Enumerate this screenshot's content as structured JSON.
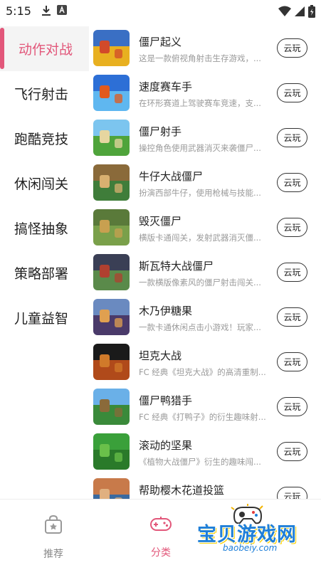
{
  "status_bar": {
    "time": "5:15"
  },
  "sidebar": {
    "items": [
      {
        "label": "动作对战",
        "active": true
      },
      {
        "label": "飞行射击",
        "active": false
      },
      {
        "label": "跑酷竞技",
        "active": false
      },
      {
        "label": "休闲闯关",
        "active": false
      },
      {
        "label": "搞怪抽象",
        "active": false
      },
      {
        "label": "策略部署",
        "active": false
      },
      {
        "label": "儿童益智",
        "active": false
      }
    ]
  },
  "games": [
    {
      "title": "僵尸起义",
      "desc": "这是一款俯视角射击生存游戏，...",
      "button": "云玩",
      "thumb_colors": [
        "#3a6fc4",
        "#e8b020",
        "#d24a2a"
      ]
    },
    {
      "title": "速度赛车手",
      "desc": "在环形赛道上驾驶赛车竞速，支...",
      "button": "云玩",
      "thumb_colors": [
        "#2d6fd6",
        "#5fb7f0",
        "#e25a1c"
      ]
    },
    {
      "title": "僵尸射手",
      "desc": "操控角色使用武器消灭来袭僵尸...",
      "button": "云玩",
      "thumb_colors": [
        "#7cc5ef",
        "#4fa43b",
        "#e6d6a0"
      ]
    },
    {
      "title": "牛仔大战僵尸",
      "desc": "扮演西部牛仔，使用枪械与技能...",
      "button": "云玩",
      "thumb_colors": [
        "#8a6a3a",
        "#3f7d3a",
        "#d8b070"
      ]
    },
    {
      "title": "毁灭僵尸",
      "desc": "横版卡通闯关，发射武器消灭僵...",
      "button": "云玩",
      "thumb_colors": [
        "#5a7a3a",
        "#7aa04a",
        "#c8a050"
      ]
    },
    {
      "title": "斯瓦特大战僵尸",
      "desc": "一款横版像素风的僵尸射击闯关...",
      "button": "云玩",
      "thumb_colors": [
        "#3a3f55",
        "#5a8a4a",
        "#b04030"
      ]
    },
    {
      "title": "木乃伊糖果",
      "desc": "一款卡通休闲点击小游戏！玩家...",
      "button": "云玩",
      "thumb_colors": [
        "#6a8ac0",
        "#4a3a6a",
        "#e0a050"
      ]
    },
    {
      "title": "坦克大战",
      "desc": "FC 经典《坦克大战》的高清重制...",
      "button": "云玩",
      "thumb_colors": [
        "#1a1a1a",
        "#b04a1a",
        "#d07a2a"
      ]
    },
    {
      "title": "僵尸鸭猎手",
      "desc": "FC 经典《打鸭子》的衍生趣味射...",
      "button": "云玩",
      "thumb_colors": [
        "#6ab0e8",
        "#3a8a3a",
        "#8a6a3a"
      ]
    },
    {
      "title": "滚动的坚果",
      "desc": "《植物大战僵尸》衍生的趣味闯...",
      "button": "云玩",
      "thumb_colors": [
        "#3aa03a",
        "#2a7a2a",
        "#6ac04a"
      ]
    },
    {
      "title": "帮助樱木花道投篮",
      "desc": "",
      "button": "云玩",
      "thumb_colors": [
        "#c87a4a",
        "#3a6aa0",
        "#e0b080"
      ]
    }
  ],
  "bottom_nav": {
    "tabs": [
      {
        "label": "推荐",
        "icon": "star-bag-icon",
        "active": false
      },
      {
        "label": "分类",
        "icon": "gamepad-icon",
        "active": true
      }
    ]
  },
  "watermark": {
    "title": "宝贝游戏网",
    "url": "baobeiy.com"
  },
  "colors": {
    "accent": "#e2577a",
    "sidebar_active_bg": "#f4f4f4",
    "desc_text": "#9a9a9a"
  }
}
